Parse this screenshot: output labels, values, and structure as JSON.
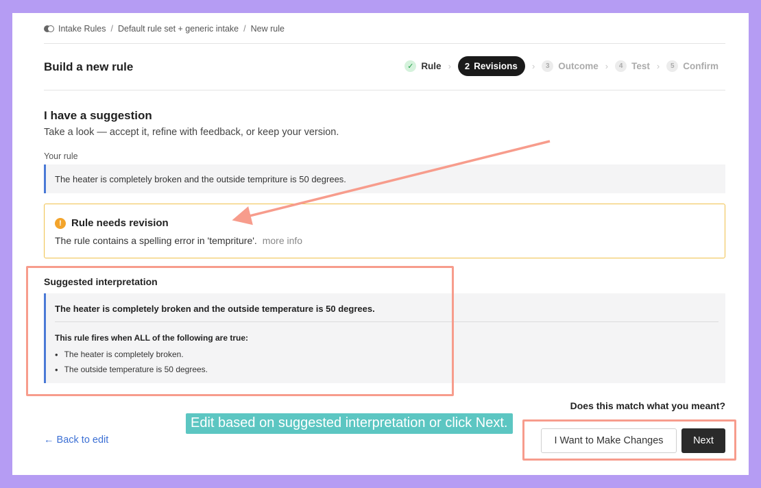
{
  "breadcrumb": {
    "items": [
      "Intake Rules",
      "Default rule set + generic intake",
      "New rule"
    ],
    "separator": "/"
  },
  "header": {
    "title": "Build a new rule",
    "steps": [
      {
        "num": "✓",
        "label": "Rule",
        "state": "done"
      },
      {
        "num": "2",
        "label": "Revisions",
        "state": "active"
      },
      {
        "num": "3",
        "label": "Outcome",
        "state": "pending"
      },
      {
        "num": "4",
        "label": "Test",
        "state": "pending"
      },
      {
        "num": "5",
        "label": "Confirm",
        "state": "pending"
      }
    ]
  },
  "suggestion": {
    "heading": "I have a suggestion",
    "subtext": "Take a look — accept it, refine with feedback, or keep your version.",
    "your_rule_label": "Your rule",
    "your_rule_text": "The heater is completely broken and the outside tempriture is 50 degrees."
  },
  "warning": {
    "icon": "exclamation-icon",
    "title": "Rule needs revision",
    "text": "The rule contains a spelling error in 'tempriture'.",
    "more_info": "more info",
    "color": "#f0c04a"
  },
  "interpretation": {
    "label": "Suggested interpretation",
    "main_text": "The heater is completely broken and the outside temperature is 50 degrees.",
    "conditions_intro": "This rule fires when ALL of the following are true:",
    "conditions": [
      "The heater is completely broken.",
      "The outside temperature is 50 degrees."
    ]
  },
  "footer": {
    "question": "Does this match what you meant?",
    "back_label": "← Back to edit",
    "changes_label": "I Want to Make Changes",
    "next_label": "Next"
  },
  "annotation": {
    "callout_text": "Edit based on suggested interpretation or click Next.",
    "highlight_color": "#f79c8c",
    "callout_color": "#5cc6c2"
  },
  "colors": {
    "background": "#b59cf3",
    "accent_blue": "#4a79d6",
    "link": "#3b6fd4"
  }
}
